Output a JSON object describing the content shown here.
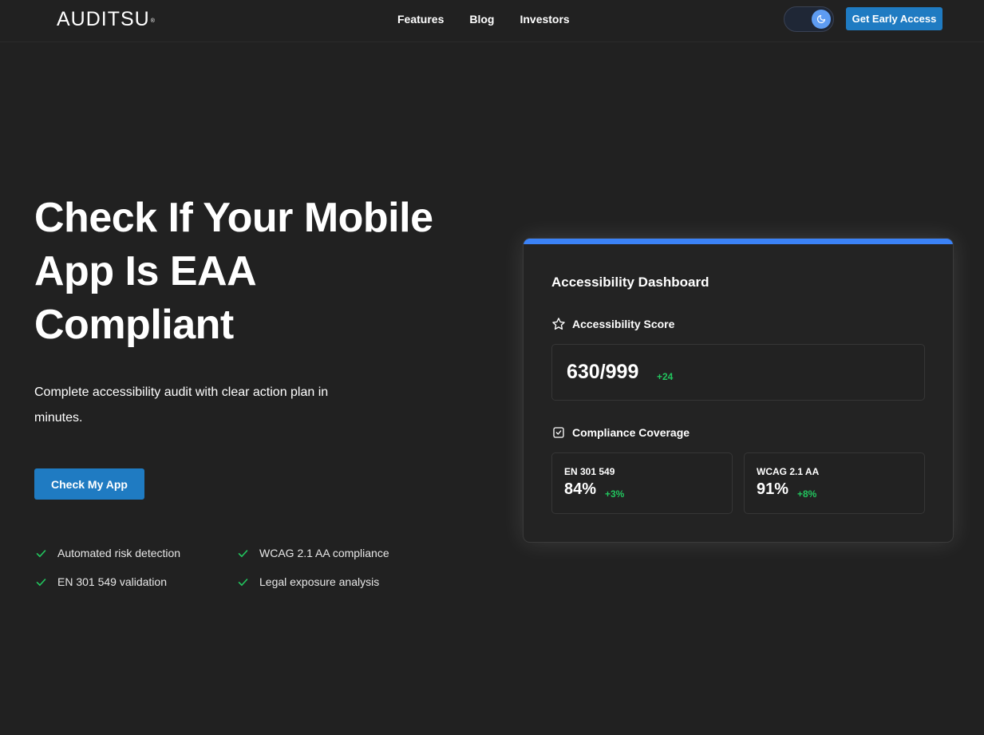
{
  "nav": {
    "logo_text": "AUDITSU",
    "logo_mark": "®",
    "links": [
      {
        "label": "Features"
      },
      {
        "label": "Blog"
      },
      {
        "label": "Investors"
      }
    ],
    "theme_toggle_icon": "moon-icon",
    "cta_label": "Get Early Access"
  },
  "hero": {
    "title": "Check If Your Mobile App Is EAA Compliant",
    "subtitle": "Complete accessibility audit with clear action plan in minutes.",
    "button_label": "Check My App",
    "features": [
      {
        "label": "Automated risk detection"
      },
      {
        "label": "WCAG 2.1 AA compliance"
      },
      {
        "label": "EN 301 549 validation"
      },
      {
        "label": "Legal exposure analysis"
      }
    ]
  },
  "dashboard": {
    "title": "Accessibility Dashboard",
    "score_section": {
      "label": "Accessibility Score",
      "icon": "star-icon",
      "value": "630/999",
      "delta": "+24"
    },
    "coverage_section": {
      "label": "Compliance Coverage",
      "icon": "checkbox-icon",
      "items": [
        {
          "label": "EN 301 549",
          "value": "84%",
          "delta": "+3%"
        },
        {
          "label": "WCAG 2.1 AA",
          "value": "91%",
          "delta": "+8%"
        }
      ]
    }
  },
  "colors": {
    "background": "#212121",
    "accent_button": "#1f7bc2",
    "card_top_bar": "#3b82f6",
    "positive_delta": "#22c55e",
    "check_icon": "#22c55e"
  }
}
